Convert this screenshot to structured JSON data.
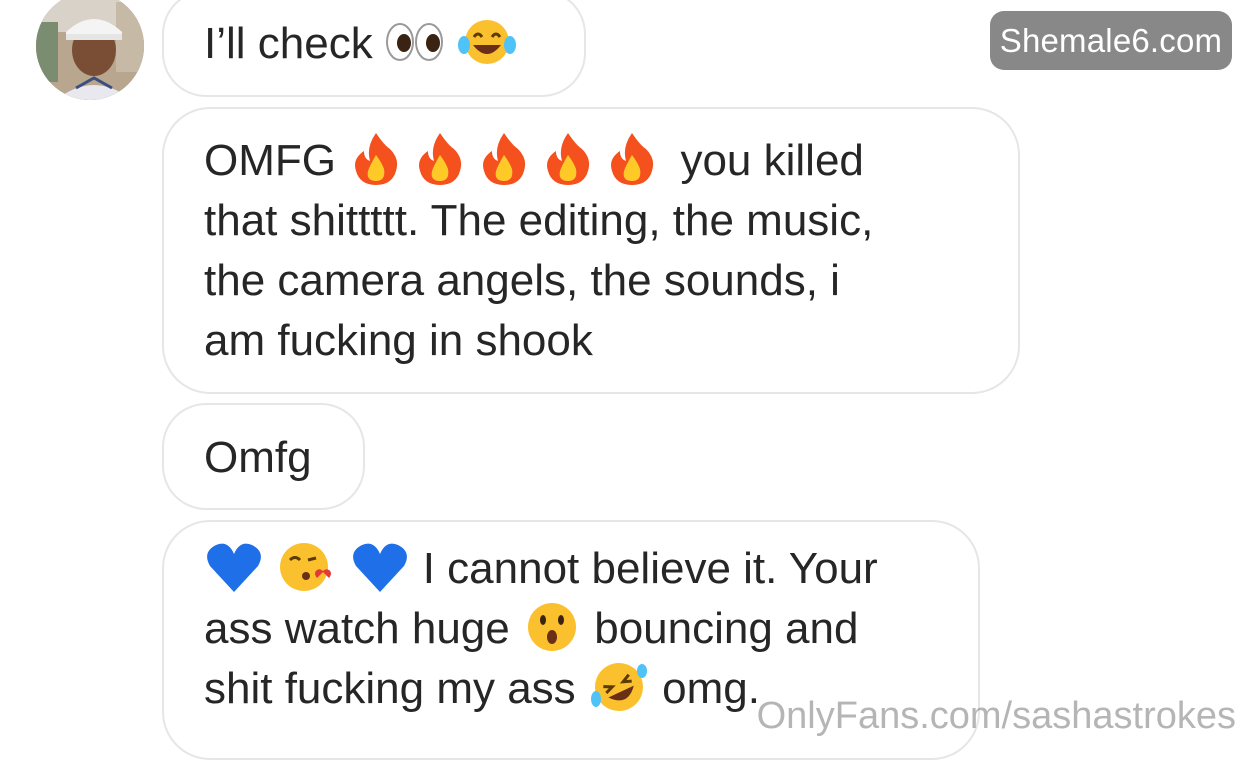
{
  "watermarks": {
    "top": "Shemale6.com",
    "bottom": "OnlyFans.com/sashastrokes"
  },
  "messages": [
    {
      "pre": "I’ll check",
      "emojis": [
        "eyes-emoji",
        "tears-of-joy-emoji"
      ]
    },
    {
      "line1_text": "OMFG",
      "line1_emojis": [
        "fire-emoji",
        "fire-emoji",
        "fire-emoji",
        "fire-emoji",
        "fire-emoji"
      ],
      "line1_after": "you killed",
      "line2": "that shittttt. The editing, the music,",
      "line3": "the camera angels, the sounds, i",
      "line4": "am fucking in shook"
    },
    {
      "text": "Omfg"
    },
    {
      "line1_emojis": [
        "blue-heart-emoji",
        "kissing-heart-emoji",
        "blue-heart-emoji"
      ],
      "line1_after": "I cannot believe it. Your",
      "line2_before": "ass watch huge",
      "line2_emoji": "astonished-face-emoji",
      "line2_after": "bouncing and",
      "line3_before": "shit fucking my ass",
      "line3_emoji": "rolling-laughing-emoji",
      "line3_after": "omg."
    }
  ],
  "colors": {
    "bubble_border": "#e6e6e6",
    "text": "#262626",
    "watermark_bg": "#888888"
  }
}
